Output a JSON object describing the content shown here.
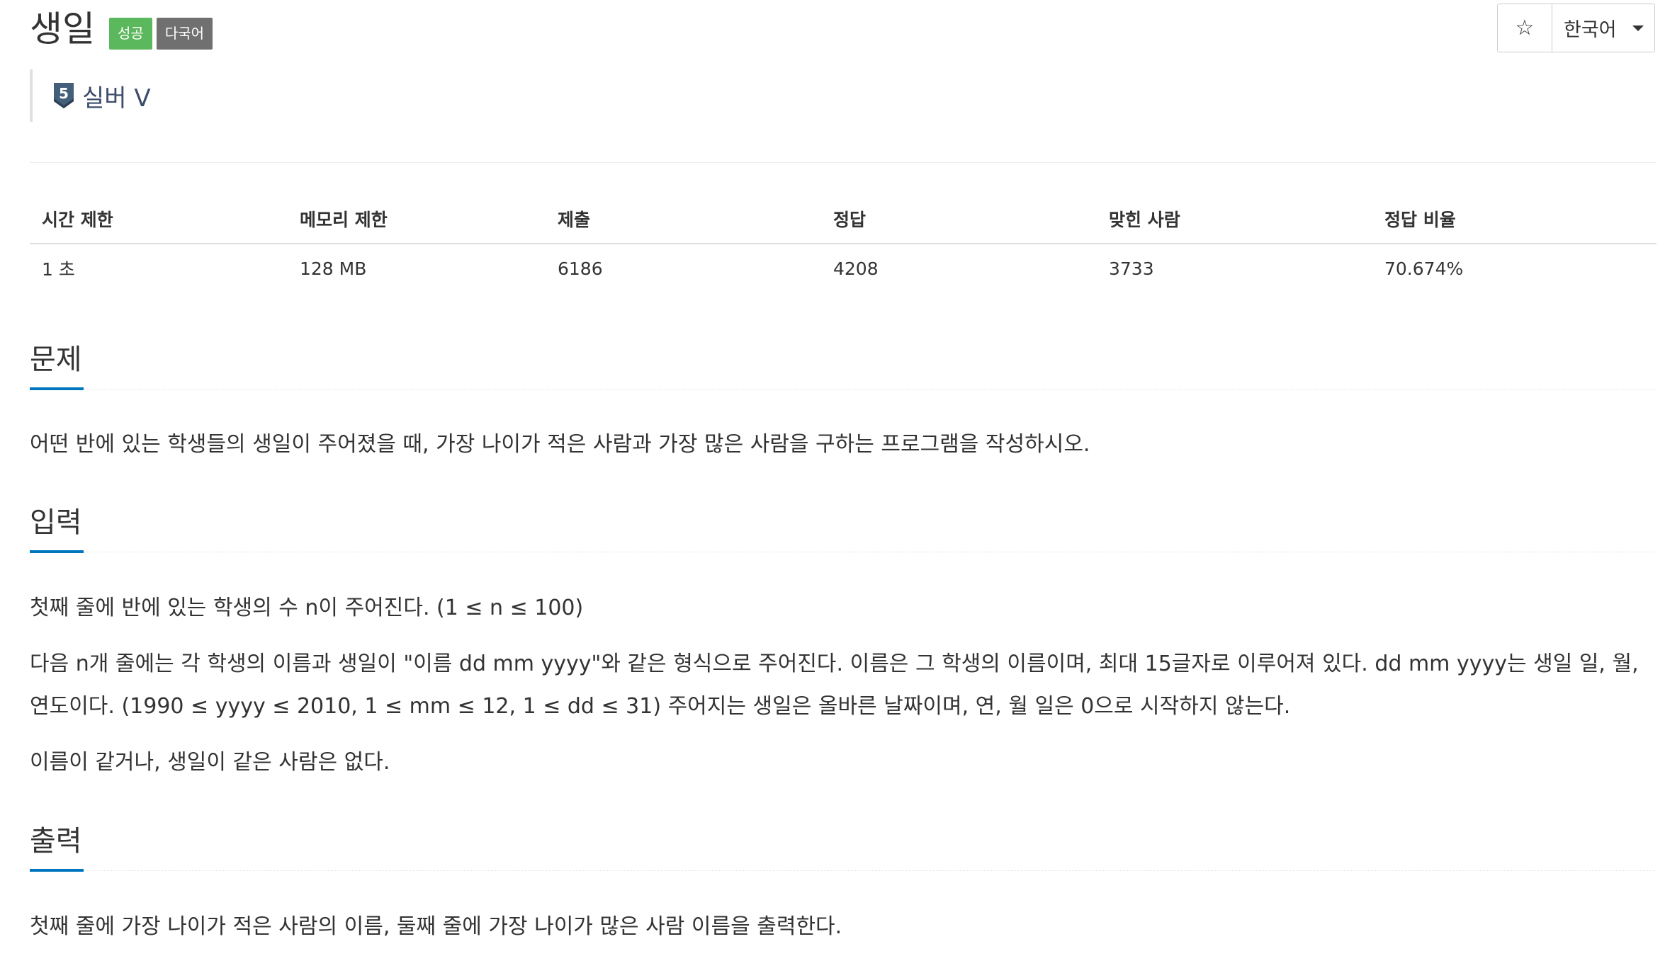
{
  "problem": {
    "title": "생일",
    "labels": {
      "success": "성공",
      "multilang": "다국어"
    },
    "tier": "실버 V",
    "tier_number": "5"
  },
  "controls": {
    "star_symbol": "☆",
    "language": "한국어"
  },
  "info_table": {
    "headers": [
      "시간 제한",
      "메모리 제한",
      "제출",
      "정답",
      "맞힌 사람",
      "정답 비율"
    ],
    "values": [
      "1 초",
      "128 MB",
      "6186",
      "4208",
      "3733",
      "70.674%"
    ]
  },
  "sections": {
    "problem": {
      "heading": "문제",
      "text": "어떤 반에 있는 학생들의 생일이 주어졌을 때, 가장 나이가 적은 사람과 가장 많은 사람을 구하는 프로그램을 작성하시오."
    },
    "input": {
      "heading": "입력",
      "paragraphs": [
        "첫째 줄에 반에 있는 학생의 수 n이 주어진다. (1 ≤ n ≤ 100)",
        "다음 n개 줄에는 각 학생의 이름과 생일이 \"이름 dd mm yyyy\"와 같은 형식으로 주어진다. 이름은 그 학생의 이름이며, 최대 15글자로 이루어져 있다. dd mm yyyy는 생일 일, 월, 연도이다. (1990 ≤ yyyy ≤ 2010, 1 ≤ mm ≤ 12, 1 ≤ dd ≤ 31) 주어지는 생일은 올바른 날짜이며, 연, 월 일은 0으로 시작하지 않는다.",
        "이름이 같거나, 생일이 같은 사람은 없다."
      ]
    },
    "output": {
      "heading": "출력",
      "text": "첫째 줄에 가장 나이가 적은 사람의 이름, 둘째 줄에 가장 나이가 많은 사람 이름을 출력한다."
    }
  },
  "colors": {
    "success_label": "#5cb85c",
    "default_label": "#707070",
    "headline_underline": "#0076c0",
    "tier_silver": "#435f7a"
  }
}
